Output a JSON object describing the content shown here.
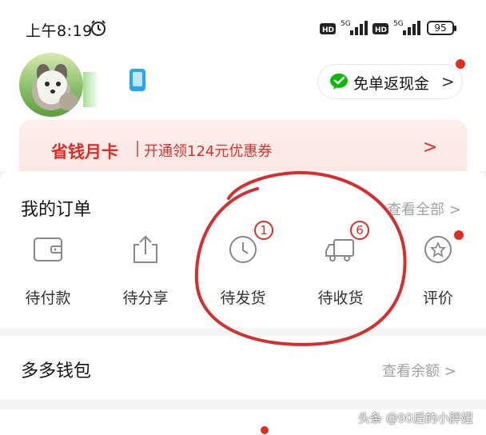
{
  "status_bar": {
    "time": "上午8:19",
    "signal_label_1": "5G",
    "signal_label_2": "5G",
    "hd_1": "HD",
    "hd_2": "HD",
    "battery": "95"
  },
  "profile": {
    "avatar_icon": "pet-photo-avatar",
    "device_icon": "phone-icon"
  },
  "cashback_button": {
    "label": "免单返现金",
    "icon": "wechat-icon"
  },
  "month_card": {
    "title": "省钱月卡",
    "subtitle": "开通领124元优惠券"
  },
  "orders": {
    "title": "我的订单",
    "view_all": "查看全部",
    "items": [
      {
        "label": "待付款",
        "icon": "wallet-icon"
      },
      {
        "label": "待分享",
        "icon": "share-icon"
      },
      {
        "label": "待发货",
        "icon": "clock-icon",
        "badge": "1"
      },
      {
        "label": "待收货",
        "icon": "truck-icon",
        "badge": "6"
      },
      {
        "label": "评价",
        "icon": "review-icon"
      }
    ]
  },
  "wallet": {
    "title": "多多钱包",
    "view_balance": "查看余额"
  },
  "watermark": "头条 @90后的小胖妞",
  "colors": {
    "accent": "#e02e24",
    "wechat_green": "#09bb07",
    "annotation_red": "#d62d2d"
  }
}
